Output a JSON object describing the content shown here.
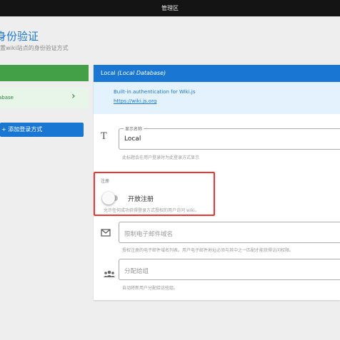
{
  "topbar": {
    "title": "管理区"
  },
  "page": {
    "title": "身份验证",
    "subtitle": "置wiki站点的身份验证方式"
  },
  "sidebar": {
    "active_item": {
      "label": "abase"
    },
    "add_button": "+ 添加登录方式"
  },
  "strategy": {
    "header_name": "Local",
    "header_detail": "(Local Database)",
    "description": "Built-in authentication for Wiki.js",
    "link": "https://wiki.js.org"
  },
  "display_name": {
    "legend": "显示名称",
    "value": "Local",
    "hint": "此标题会在用户登录时为此登录方式显示"
  },
  "registration": {
    "section_label": "注册",
    "toggle_label": "开放注册",
    "toggle_on": false,
    "hint": "允许任何成功获得登录方式授权的用户访问 wiki。"
  },
  "email_domains": {
    "placeholder": "限制电子邮件域名",
    "hint": "授权注册的电子邮件域名列表。用户电子邮件地址必须与其中之一匹配才能获得访问权限。"
  },
  "assign_group": {
    "placeholder": "分配给组",
    "hint": "自动将新用户分配给这些组。"
  },
  "colors": {
    "primary": "#1976d2",
    "success": "#43a047",
    "highlight": "#e53935"
  }
}
